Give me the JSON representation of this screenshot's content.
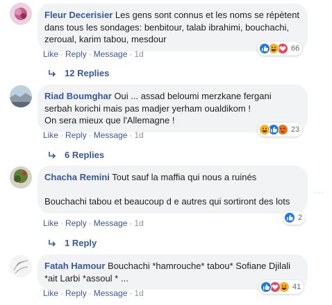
{
  "comments": [
    {
      "author": "Fleur Decerisier",
      "text": " Les gens sont connus et les noms se répètent dans tous les sondages: benbitour, talab ibrahimi, bouchachi, zeroual, karim tabou, mesdour",
      "like": "Like",
      "reply": "Reply",
      "message": "Message",
      "time": "1d",
      "reaction_count": "66",
      "reactions": [
        "like-icon",
        "haha-icon",
        "love-icon"
      ],
      "replies_label": "12 Replies"
    },
    {
      "author": "Riad Boumghar",
      "text": " Oui ... assad beloumi merzkane fergani serbah korichi mais pas madjer yerham oualdikom !\nOn sera mieux que l'Allemagne !",
      "like": "Like",
      "reply": "Reply",
      "message": "Message",
      "time": "1d",
      "reaction_count": "23",
      "reactions": [
        "haha-icon",
        "like-icon",
        "angry-icon"
      ],
      "replies_label": "6 Replies"
    },
    {
      "author": "Chacha Remini",
      "text": " Tout sauf la maffia qui nous a ruinés\n\nBouchachi tabou et beaucoup d e autres qui sortiront des lots",
      "like": "Like",
      "reply": "Reply",
      "message": "Message",
      "time": "1d",
      "reaction_count": "2",
      "reactions": [
        "like-icon"
      ],
      "replies_label": "1 Reply"
    },
    {
      "author": "Fatah Hamour",
      "text": " Bouchachi *hamrouche* tabou* Sofiane Djilali *ait Larbi *assoul * ...",
      "like": "Like",
      "reply": "Reply",
      "message": "Message",
      "time": "1d",
      "reaction_count": "41",
      "reactions": [
        "like-icon",
        "love-icon",
        "haha-icon"
      ]
    }
  ],
  "colors": {
    "link": "#385898",
    "bubble": "#f2f3f5",
    "like": "#1877f2",
    "love": "#f33e58",
    "haha": "#f7b125",
    "angry": "#e9710f"
  },
  "more_options": "···"
}
